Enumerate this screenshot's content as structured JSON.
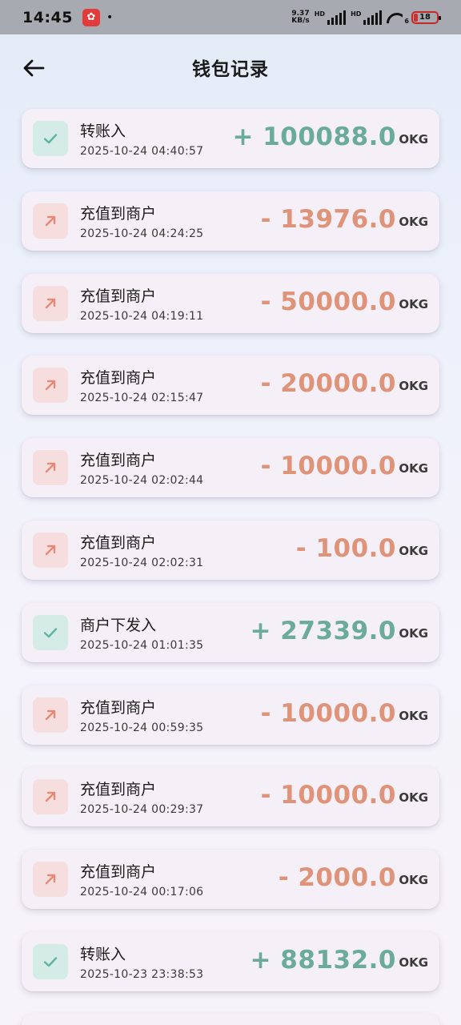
{
  "status_bar": {
    "time": "14:45",
    "net_speed_value": "9.37",
    "net_speed_unit": "KB/s",
    "sim1_label": "HD",
    "sim2_label": "HD",
    "wifi_sub": "6",
    "battery": "18",
    "colors": {
      "battery_low": "#d32f2f"
    }
  },
  "header": {
    "title": "钱包记录",
    "back_icon": "arrow-left-icon"
  },
  "colors": {
    "income": "#6aab9b",
    "expense": "#df9378",
    "income_icon_bg": "#d4ebe6",
    "expense_icon_bg": "#f7dede"
  },
  "unit_label": "OKG",
  "records": [
    {
      "type": "in",
      "icon": "check-icon",
      "title": "转账入",
      "time": "2025-10-24 04:40:57",
      "amount": "+ 100088.0",
      "unit": "OKG"
    },
    {
      "type": "out",
      "icon": "arrow-up-right-icon",
      "title": "充值到商户",
      "time": "2025-10-24 04:24:25",
      "amount": "- 13976.0",
      "unit": "OKG"
    },
    {
      "type": "out",
      "icon": "arrow-up-right-icon",
      "title": "充值到商户",
      "time": "2025-10-24 04:19:11",
      "amount": "- 50000.0",
      "unit": "OKG"
    },
    {
      "type": "out",
      "icon": "arrow-up-right-icon",
      "title": "充值到商户",
      "time": "2025-10-24 02:15:47",
      "amount": "- 20000.0",
      "unit": "OKG"
    },
    {
      "type": "out",
      "icon": "arrow-up-right-icon",
      "title": "充值到商户",
      "time": "2025-10-24 02:02:44",
      "amount": "- 10000.0",
      "unit": "OKG"
    },
    {
      "type": "out",
      "icon": "arrow-up-right-icon",
      "title": "充值到商户",
      "time": "2025-10-24 02:02:31",
      "amount": "- 100.0",
      "unit": "OKG"
    },
    {
      "type": "in",
      "icon": "check-icon",
      "title": "商户下发入",
      "time": "2025-10-24 01:01:35",
      "amount": "+ 27339.0",
      "unit": "OKG"
    },
    {
      "type": "out",
      "icon": "arrow-up-right-icon",
      "title": "充值到商户",
      "time": "2025-10-24 00:59:35",
      "amount": "- 10000.0",
      "unit": "OKG"
    },
    {
      "type": "out",
      "icon": "arrow-up-right-icon",
      "title": "充值到商户",
      "time": "2025-10-24 00:29:37",
      "amount": "- 10000.0",
      "unit": "OKG"
    },
    {
      "type": "out",
      "icon": "arrow-up-right-icon",
      "title": "充值到商户",
      "time": "2025-10-24 00:17:06",
      "amount": "- 2000.0",
      "unit": "OKG"
    },
    {
      "type": "in",
      "icon": "check-icon",
      "title": "转账入",
      "time": "2025-10-23 23:38:53",
      "amount": "+ 88132.0",
      "unit": "OKG"
    }
  ]
}
